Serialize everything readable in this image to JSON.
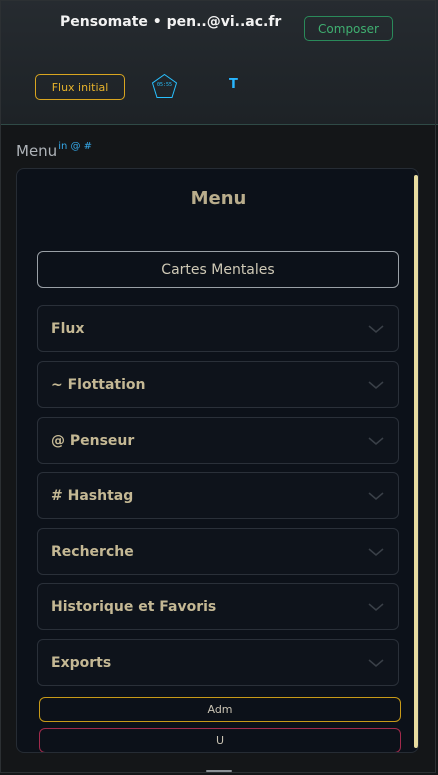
{
  "header": {
    "app_title": "Pensomate • pen..@vi..ac.fr",
    "compose_label": "Composer",
    "flux_initial_label": "Flux initial",
    "timer_text": "05:55",
    "t_label": "T"
  },
  "menu_caption": {
    "label": "Menu",
    "superscript": "in @ #"
  },
  "panel": {
    "title": "Menu",
    "mind_maps_label": "Cartes Mentales",
    "accordion": [
      {
        "label": "Flux"
      },
      {
        "label": "~ Flottation"
      },
      {
        "label": "@ Penseur"
      },
      {
        "label": "# Hashtag"
      },
      {
        "label": "Recherche"
      },
      {
        "label": "Historique et Favoris"
      },
      {
        "label": "Exports"
      }
    ],
    "adm_label": "Adm",
    "u_label": "U"
  },
  "colors": {
    "compose": "#3fae70",
    "flux_initial": "#e6b22b",
    "accent_blue": "#28b6ff",
    "adm_border": "#c89a18",
    "u_border": "#a12a4c"
  },
  "icons": [
    "pentagon-timer-icon",
    "chevron-down-icon"
  ]
}
